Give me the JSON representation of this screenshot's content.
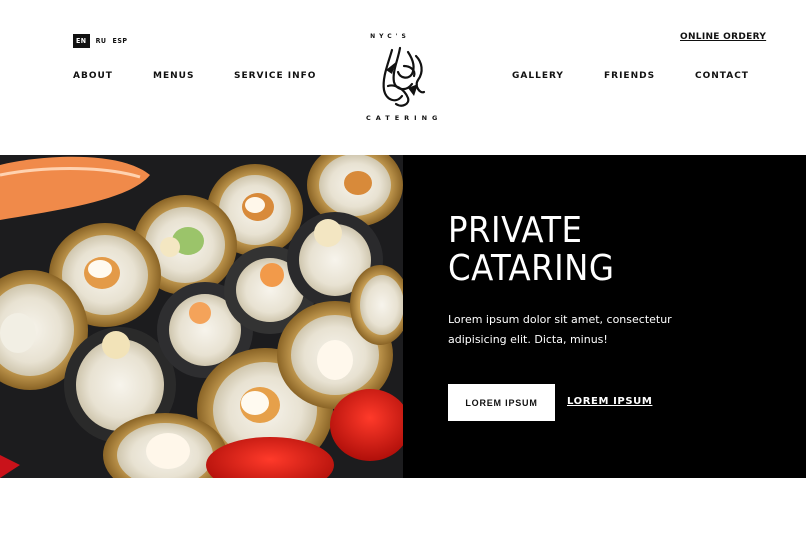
{
  "header": {
    "languages": [
      "EN",
      "RU",
      "ESP"
    ],
    "active_language": "EN",
    "online_order": "ONLINE ORDERY",
    "nav_left": [
      "ABOUT",
      "MENUS",
      "SERVICE INFO"
    ],
    "nav_right": [
      "GALLERY",
      "FRIENDS",
      "CONTACT"
    ],
    "logo_top": "NYC'S",
    "logo_bottom": "CATERING"
  },
  "hero": {
    "title_line1": "PRIVATE",
    "title_line2": "CATARING",
    "body": "Lorem ipsum dolor sit amet, consectetur adipisicing elit. Dicta, minus!",
    "primary_button": "LOREM IPSUM",
    "secondary_link": "LOREM IPSUM"
  },
  "colors": {
    "background": "#ffffff",
    "panel": "#000000",
    "text": "#111111"
  }
}
